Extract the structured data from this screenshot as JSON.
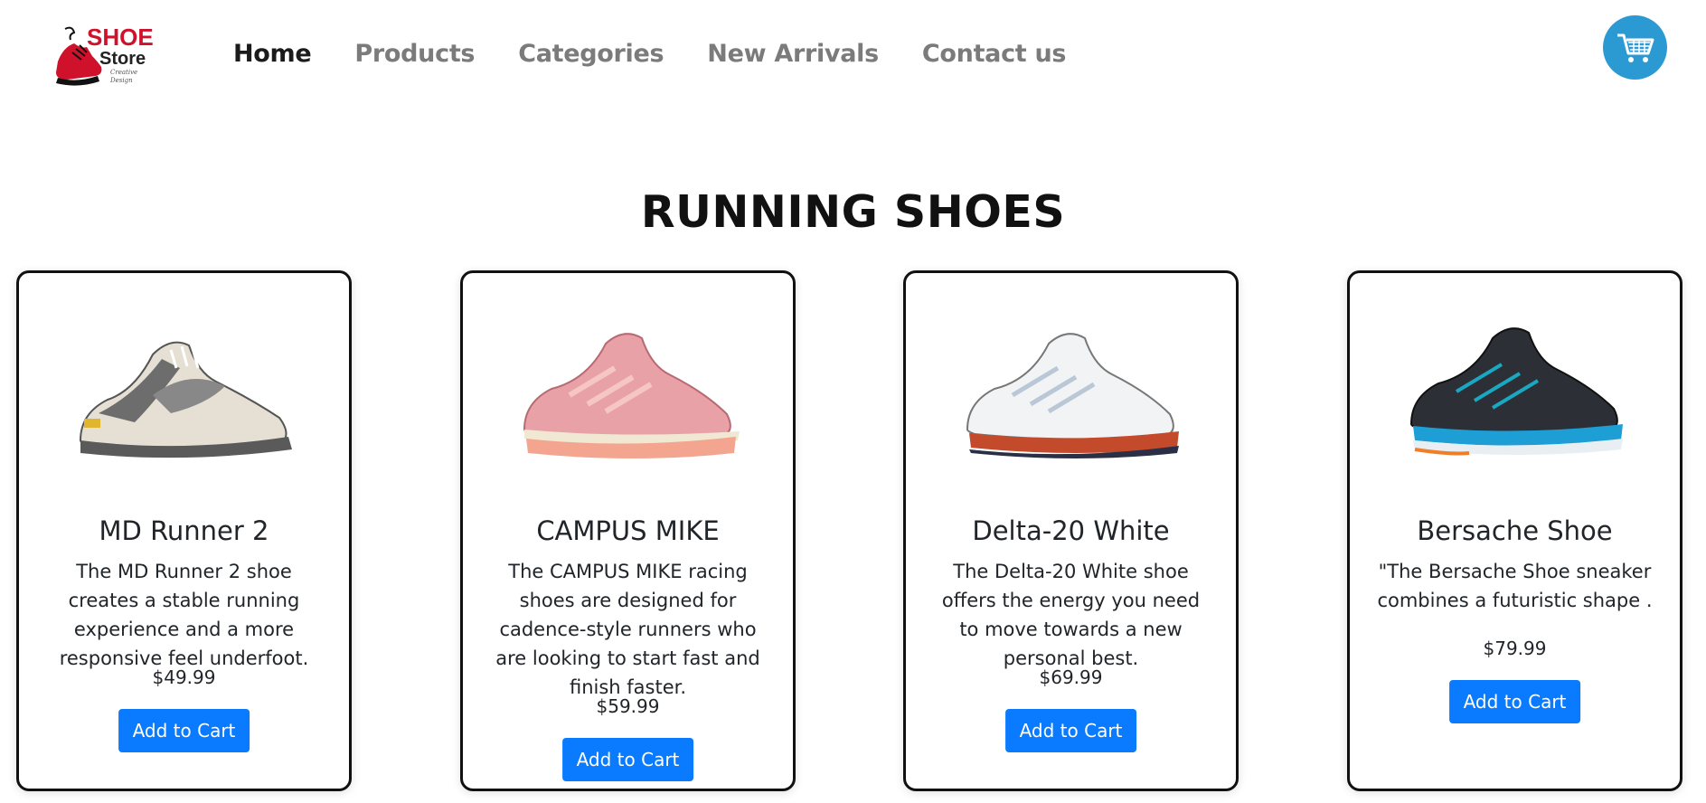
{
  "logo": {
    "shoe_word": "SHOE",
    "store_word": "Store",
    "tagline_1": "Creative",
    "tagline_2": "Design"
  },
  "nav": {
    "items": [
      {
        "label": "Home",
        "active": true
      },
      {
        "label": "Products",
        "active": false
      },
      {
        "label": "Categories",
        "active": false
      },
      {
        "label": "New Arrivals",
        "active": false
      },
      {
        "label": "Contact us",
        "active": false
      }
    ]
  },
  "cart": {
    "icon": "shopping-cart-icon",
    "color": "#2b9ad2"
  },
  "section": {
    "title": "RUNNING SHOES"
  },
  "products": [
    {
      "name": "MD Runner 2",
      "description": "The MD Runner 2 shoe creates a stable running experience and a more responsive feel underfoot.",
      "price": "$49.99",
      "button": "Add to Cart",
      "image": "sneaker-gray-white"
    },
    {
      "name": "CAMPUS MIKE",
      "description": "The CAMPUS MIKE racing shoes are designed for cadence-style runners who are looking to start fast and finish faster.",
      "price": "$59.99",
      "button": "Add to Cart",
      "image": "sneaker-pink"
    },
    {
      "name": "Delta-20 White",
      "description": "The Delta-20 White shoe offers the energy you need to move towards a new personal best.",
      "price": "$69.99",
      "button": "Add to Cart",
      "image": "sneaker-white-red"
    },
    {
      "name": "Bersache Shoe",
      "description": "\"The Bersache Shoe sneaker combines a futuristic shape .",
      "price": "$79.99",
      "button": "Add to Cart",
      "image": "sneaker-black-blue"
    }
  ],
  "colors": {
    "accent": "#0a7bff",
    "brand_red": "#d0112b",
    "nav_active": "#1b1b1b",
    "nav_inactive": "#7b7b7b"
  }
}
